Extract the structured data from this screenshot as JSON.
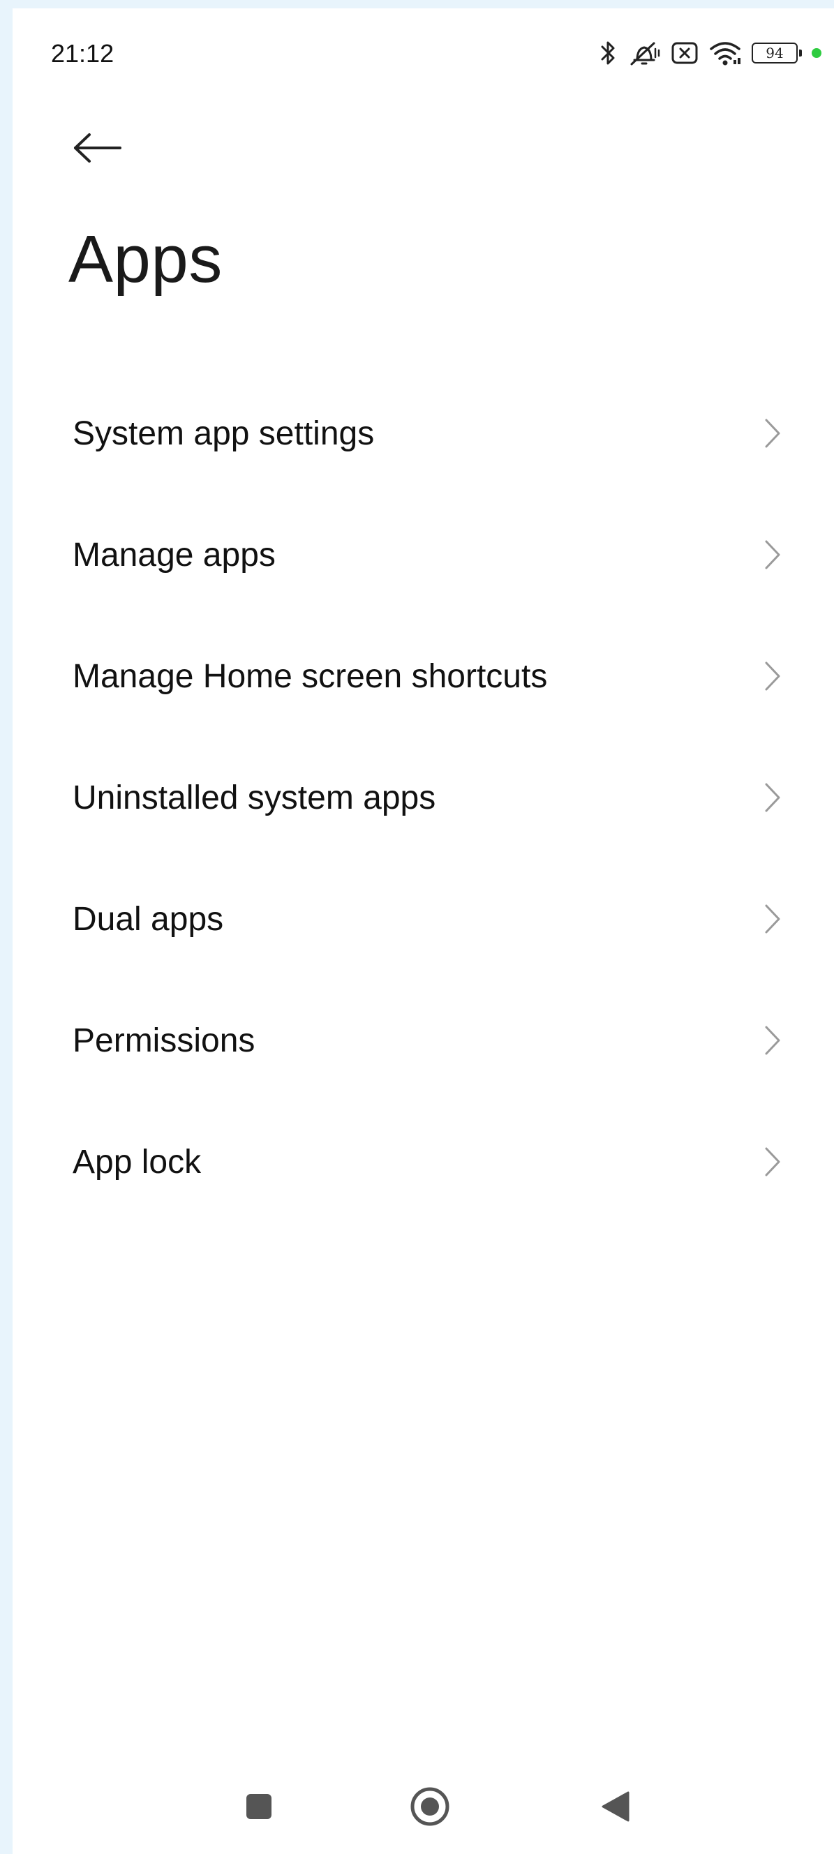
{
  "status_bar": {
    "time": "21:12",
    "battery_level": "94",
    "icons": [
      "bluetooth-icon",
      "vibrate-off-icon",
      "no-sim-icon",
      "wifi-icon",
      "battery-icon",
      "notification-dot-icon"
    ],
    "dot_color": "#2ecc40"
  },
  "header": {
    "back_icon": "back-arrow-icon",
    "title": "Apps"
  },
  "menu": {
    "items": [
      {
        "label": "System app settings"
      },
      {
        "label": "Manage apps"
      },
      {
        "label": "Manage Home screen shortcuts"
      },
      {
        "label": "Uninstalled system apps"
      },
      {
        "label": "Dual apps"
      },
      {
        "label": "Permissions"
      },
      {
        "label": "App lock"
      }
    ],
    "trailing_icon": "chevron-right-icon"
  },
  "nav_bar": {
    "buttons": [
      "recents-square-icon",
      "home-circle-icon",
      "back-triangle-icon"
    ]
  }
}
